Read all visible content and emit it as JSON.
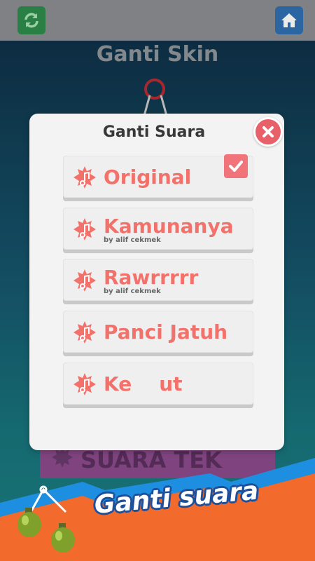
{
  "toolbar": {
    "refresh_icon": "refresh-icon",
    "home_icon": "home-icon"
  },
  "screen": {
    "title": "Ganti Skin",
    "background_banner_text": "SUARA TEK"
  },
  "modal": {
    "title": "Ganti Suara",
    "close_icon": "close-icon",
    "items": [
      {
        "label": "Original",
        "credit": "",
        "selected": true
      },
      {
        "label": "Kamunanya",
        "credit": "by alif cekmek",
        "selected": false
      },
      {
        "label": "Rawrrrrr",
        "credit": "by alif cekmek",
        "selected": false
      },
      {
        "label": "Panci Jatuh",
        "credit": "",
        "selected": false
      },
      {
        "label": "Ke    ut",
        "credit": "",
        "selected": false
      }
    ]
  },
  "promo": {
    "caption": "Ganti suara"
  },
  "colors": {
    "accent": "#f2716a",
    "close": "#e8616a",
    "promo_orange": "#f26a2c",
    "promo_blue": "#1e8fe0"
  }
}
